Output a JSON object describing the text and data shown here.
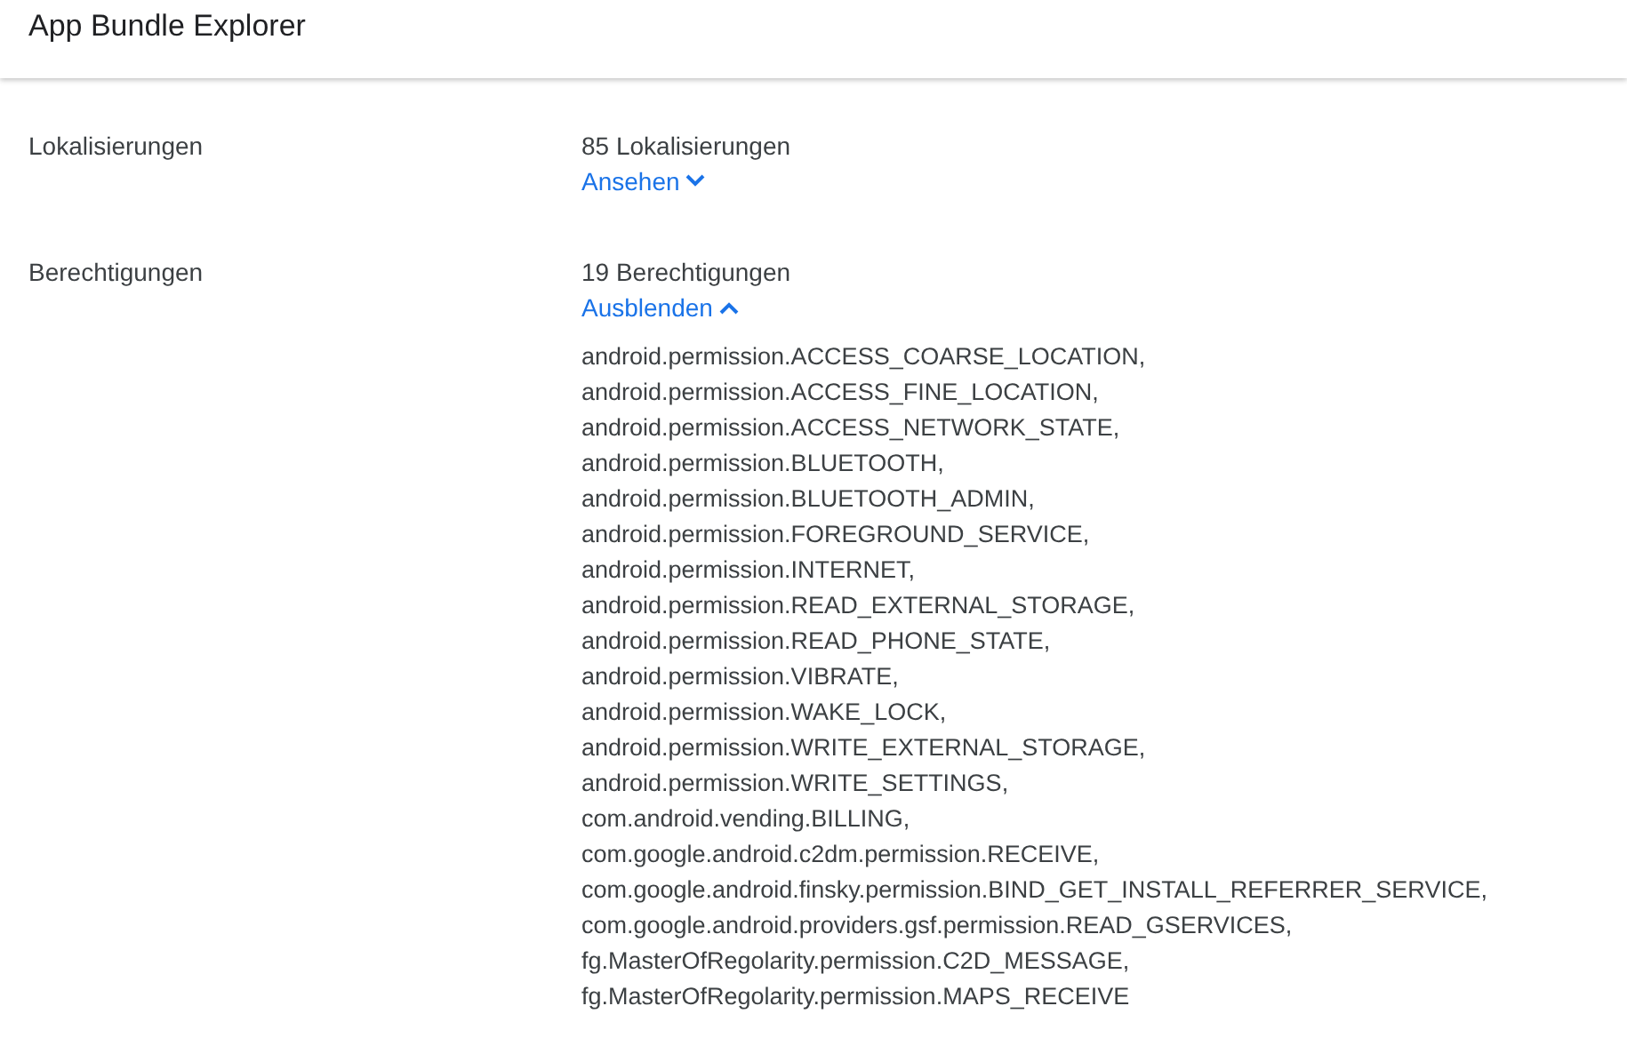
{
  "window": {
    "title": "App Bundle Explorer"
  },
  "rows": [
    {
      "label": "Lokalisierungen",
      "summary": "85 Lokalisierungen",
      "toggle": "Ansehen",
      "expanded": false
    },
    {
      "label": "Berechtigungen",
      "summary": "19 Berechtigungen",
      "toggle": "Ausblenden",
      "expanded": true,
      "items": [
        "android.permission.ACCESS_COARSE_LOCATION,",
        "android.permission.ACCESS_FINE_LOCATION,",
        "android.permission.ACCESS_NETWORK_STATE,",
        "android.permission.BLUETOOTH,",
        "android.permission.BLUETOOTH_ADMIN,",
        "android.permission.FOREGROUND_SERVICE,",
        "android.permission.INTERNET,",
        "android.permission.READ_EXTERNAL_STORAGE,",
        "android.permission.READ_PHONE_STATE,",
        "android.permission.VIBRATE,",
        "android.permission.WAKE_LOCK,",
        "android.permission.WRITE_EXTERNAL_STORAGE,",
        "android.permission.WRITE_SETTINGS,",
        "com.android.vending.BILLING,",
        "com.google.android.c2dm.permission.RECEIVE,",
        "com.google.android.finsky.permission.BIND_GET_INSTALL_REFERRER_SERVICE,",
        "com.google.android.providers.gsf.permission.READ_GSERVICES,",
        "fg.MasterOfRegolarity.permission.C2D_MESSAGE,",
        "fg.MasterOfRegolarity.permission.MAPS_RECEIVE"
      ]
    }
  ]
}
